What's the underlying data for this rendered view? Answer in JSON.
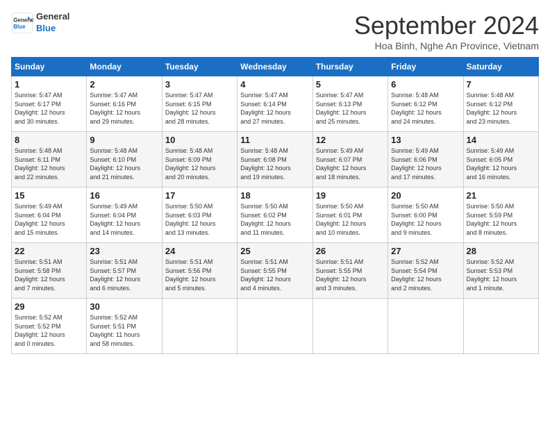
{
  "header": {
    "logo_line1": "General",
    "logo_line2": "Blue",
    "month": "September 2024",
    "location": "Hoa Binh, Nghe An Province, Vietnam"
  },
  "weekdays": [
    "Sunday",
    "Monday",
    "Tuesday",
    "Wednesday",
    "Thursday",
    "Friday",
    "Saturday"
  ],
  "weeks": [
    [
      {
        "day": "1",
        "info": "Sunrise: 5:47 AM\nSunset: 6:17 PM\nDaylight: 12 hours\nand 30 minutes."
      },
      {
        "day": "2",
        "info": "Sunrise: 5:47 AM\nSunset: 6:16 PM\nDaylight: 12 hours\nand 29 minutes."
      },
      {
        "day": "3",
        "info": "Sunrise: 5:47 AM\nSunset: 6:15 PM\nDaylight: 12 hours\nand 28 minutes."
      },
      {
        "day": "4",
        "info": "Sunrise: 5:47 AM\nSunset: 6:14 PM\nDaylight: 12 hours\nand 27 minutes."
      },
      {
        "day": "5",
        "info": "Sunrise: 5:47 AM\nSunset: 6:13 PM\nDaylight: 12 hours\nand 25 minutes."
      },
      {
        "day": "6",
        "info": "Sunrise: 5:48 AM\nSunset: 6:12 PM\nDaylight: 12 hours\nand 24 minutes."
      },
      {
        "day": "7",
        "info": "Sunrise: 5:48 AM\nSunset: 6:12 PM\nDaylight: 12 hours\nand 23 minutes."
      }
    ],
    [
      {
        "day": "8",
        "info": "Sunrise: 5:48 AM\nSunset: 6:11 PM\nDaylight: 12 hours\nand 22 minutes."
      },
      {
        "day": "9",
        "info": "Sunrise: 5:48 AM\nSunset: 6:10 PM\nDaylight: 12 hours\nand 21 minutes."
      },
      {
        "day": "10",
        "info": "Sunrise: 5:48 AM\nSunset: 6:09 PM\nDaylight: 12 hours\nand 20 minutes."
      },
      {
        "day": "11",
        "info": "Sunrise: 5:48 AM\nSunset: 6:08 PM\nDaylight: 12 hours\nand 19 minutes."
      },
      {
        "day": "12",
        "info": "Sunrise: 5:49 AM\nSunset: 6:07 PM\nDaylight: 12 hours\nand 18 minutes."
      },
      {
        "day": "13",
        "info": "Sunrise: 5:49 AM\nSunset: 6:06 PM\nDaylight: 12 hours\nand 17 minutes."
      },
      {
        "day": "14",
        "info": "Sunrise: 5:49 AM\nSunset: 6:05 PM\nDaylight: 12 hours\nand 16 minutes."
      }
    ],
    [
      {
        "day": "15",
        "info": "Sunrise: 5:49 AM\nSunset: 6:04 PM\nDaylight: 12 hours\nand 15 minutes."
      },
      {
        "day": "16",
        "info": "Sunrise: 5:49 AM\nSunset: 6:04 PM\nDaylight: 12 hours\nand 14 minutes."
      },
      {
        "day": "17",
        "info": "Sunrise: 5:50 AM\nSunset: 6:03 PM\nDaylight: 12 hours\nand 13 minutes."
      },
      {
        "day": "18",
        "info": "Sunrise: 5:50 AM\nSunset: 6:02 PM\nDaylight: 12 hours\nand 11 minutes."
      },
      {
        "day": "19",
        "info": "Sunrise: 5:50 AM\nSunset: 6:01 PM\nDaylight: 12 hours\nand 10 minutes."
      },
      {
        "day": "20",
        "info": "Sunrise: 5:50 AM\nSunset: 6:00 PM\nDaylight: 12 hours\nand 9 minutes."
      },
      {
        "day": "21",
        "info": "Sunrise: 5:50 AM\nSunset: 5:59 PM\nDaylight: 12 hours\nand 8 minutes."
      }
    ],
    [
      {
        "day": "22",
        "info": "Sunrise: 5:51 AM\nSunset: 5:58 PM\nDaylight: 12 hours\nand 7 minutes."
      },
      {
        "day": "23",
        "info": "Sunrise: 5:51 AM\nSunset: 5:57 PM\nDaylight: 12 hours\nand 6 minutes."
      },
      {
        "day": "24",
        "info": "Sunrise: 5:51 AM\nSunset: 5:56 PM\nDaylight: 12 hours\nand 5 minutes."
      },
      {
        "day": "25",
        "info": "Sunrise: 5:51 AM\nSunset: 5:55 PM\nDaylight: 12 hours\nand 4 minutes."
      },
      {
        "day": "26",
        "info": "Sunrise: 5:51 AM\nSunset: 5:55 PM\nDaylight: 12 hours\nand 3 minutes."
      },
      {
        "day": "27",
        "info": "Sunrise: 5:52 AM\nSunset: 5:54 PM\nDaylight: 12 hours\nand 2 minutes."
      },
      {
        "day": "28",
        "info": "Sunrise: 5:52 AM\nSunset: 5:53 PM\nDaylight: 12 hours\nand 1 minute."
      }
    ],
    [
      {
        "day": "29",
        "info": "Sunrise: 5:52 AM\nSunset: 5:52 PM\nDaylight: 12 hours\nand 0 minutes."
      },
      {
        "day": "30",
        "info": "Sunrise: 5:52 AM\nSunset: 5:51 PM\nDaylight: 11 hours\nand 58 minutes."
      },
      {
        "day": "",
        "info": ""
      },
      {
        "day": "",
        "info": ""
      },
      {
        "day": "",
        "info": ""
      },
      {
        "day": "",
        "info": ""
      },
      {
        "day": "",
        "info": ""
      }
    ]
  ]
}
